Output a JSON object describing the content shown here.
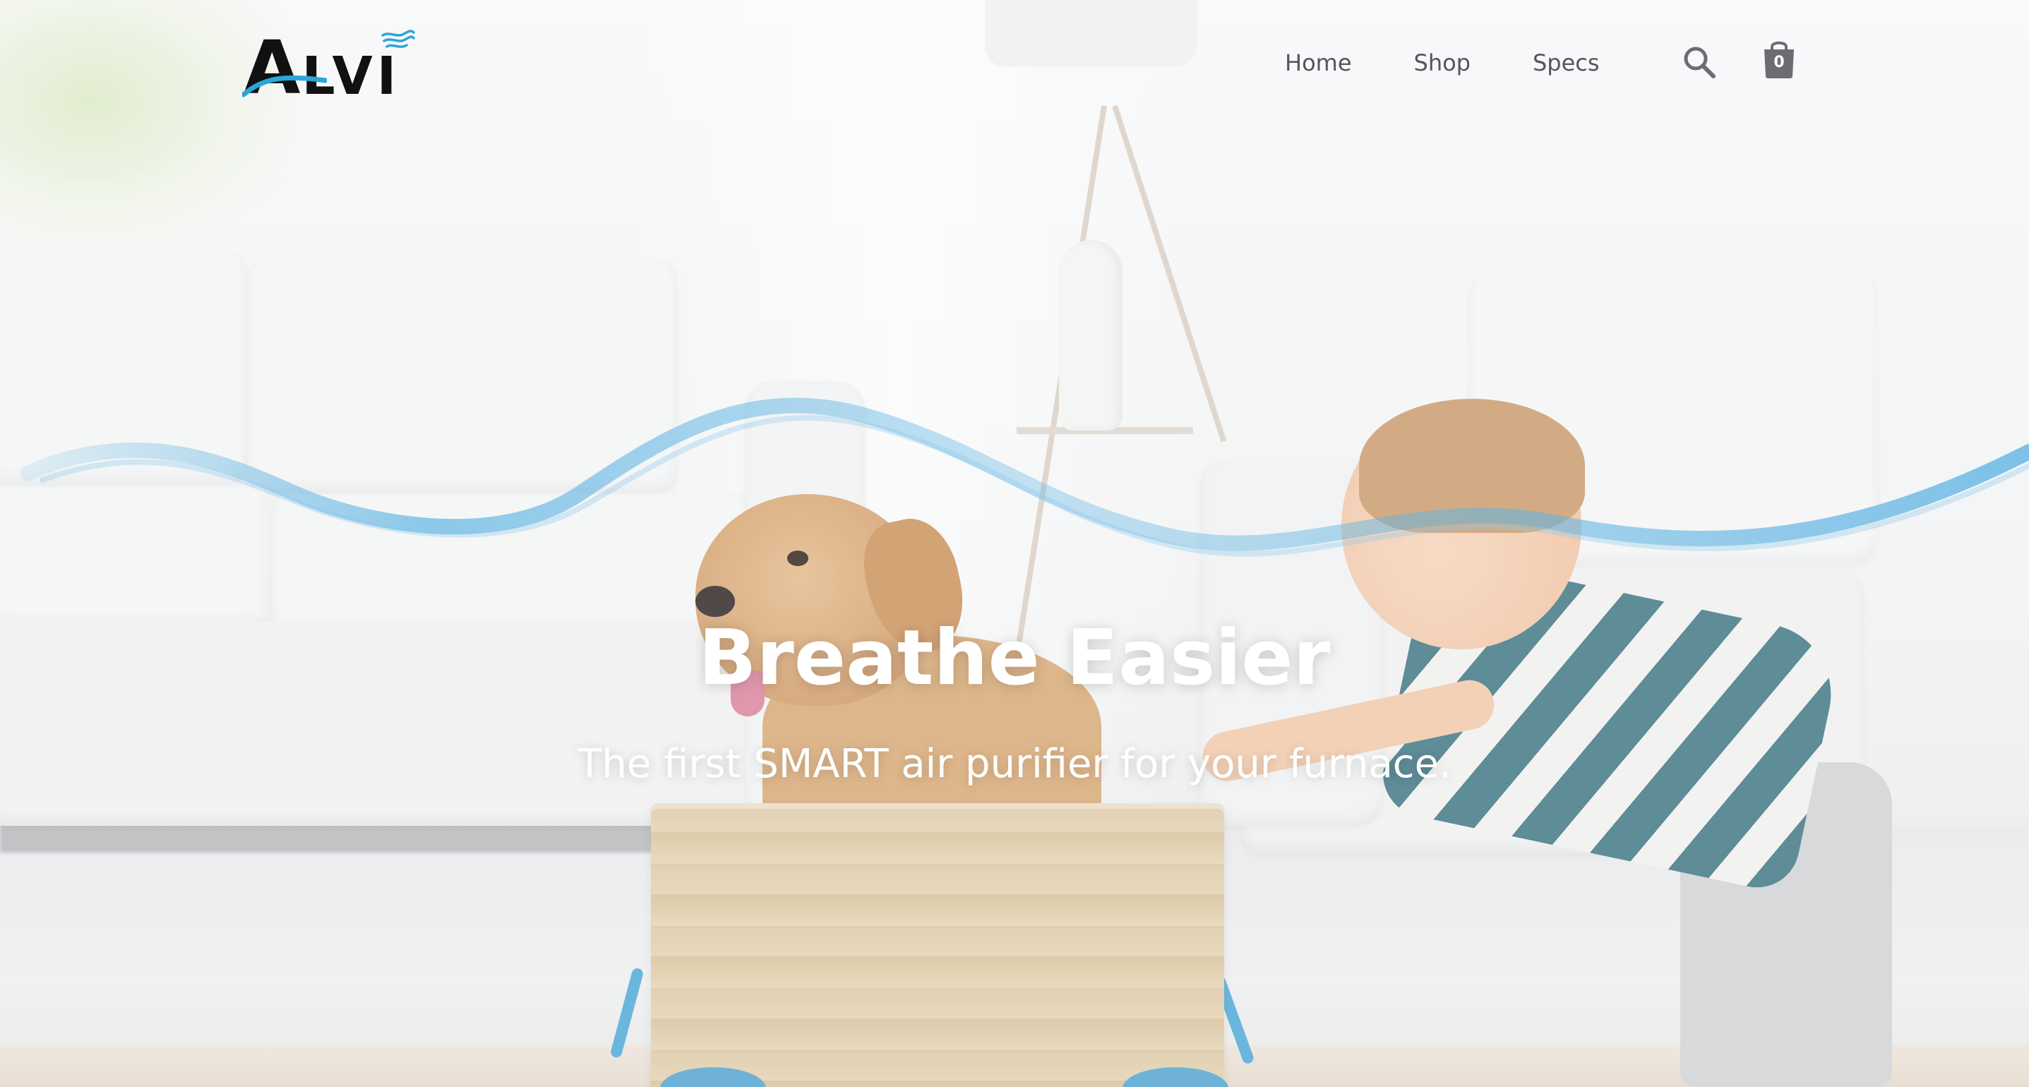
{
  "brand": {
    "logo_letter": "A",
    "logo_rest": "LVI",
    "logo_wave_color": "#2aa6d9"
  },
  "nav": {
    "items": [
      {
        "label": "Home"
      },
      {
        "label": "Shop"
      },
      {
        "label": "Specs"
      }
    ]
  },
  "header_icons": {
    "search_icon": "search-icon",
    "cart_icon": "shopping-bag-icon",
    "cart_count": "0"
  },
  "hero": {
    "title": "Breathe Easier",
    "subtitle": "The first SMART air purifier for your furnace.",
    "background": "living room with dog in wooden cart pushed by a toddler",
    "accent_wave_color": "#5fb4e3"
  }
}
